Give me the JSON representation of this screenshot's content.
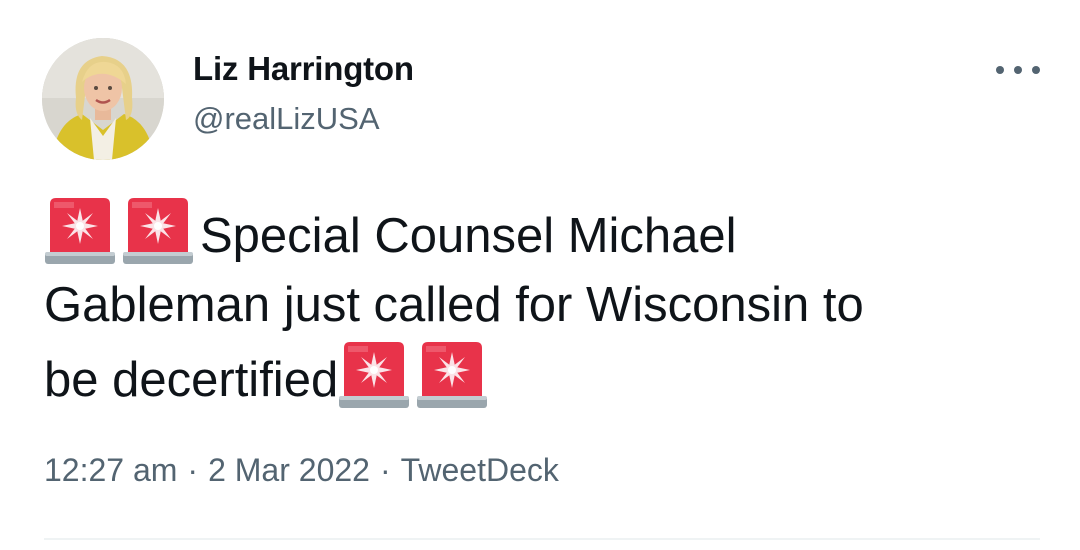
{
  "author": {
    "display_name": "Liz Harrington",
    "handle": "@realLizUSA",
    "avatar_icon": "profile-photo"
  },
  "more_menu": {
    "icon": "more-horizontal-icon"
  },
  "tweet": {
    "line1": "Special Counsel Michael",
    "line2": "Gableman just called for Wisconsin to",
    "line3": "be decertified",
    "emoji": "police-car-light-icon"
  },
  "meta": {
    "time": "12:27 am",
    "separator": "·",
    "date": "2 Mar 2022",
    "source": "TweetDeck"
  },
  "colors": {
    "text": "#0f1419",
    "secondary": "#536471",
    "siren_red": "#e8334a",
    "siren_base": "#9aa6ad",
    "divider": "#eff3f4"
  }
}
